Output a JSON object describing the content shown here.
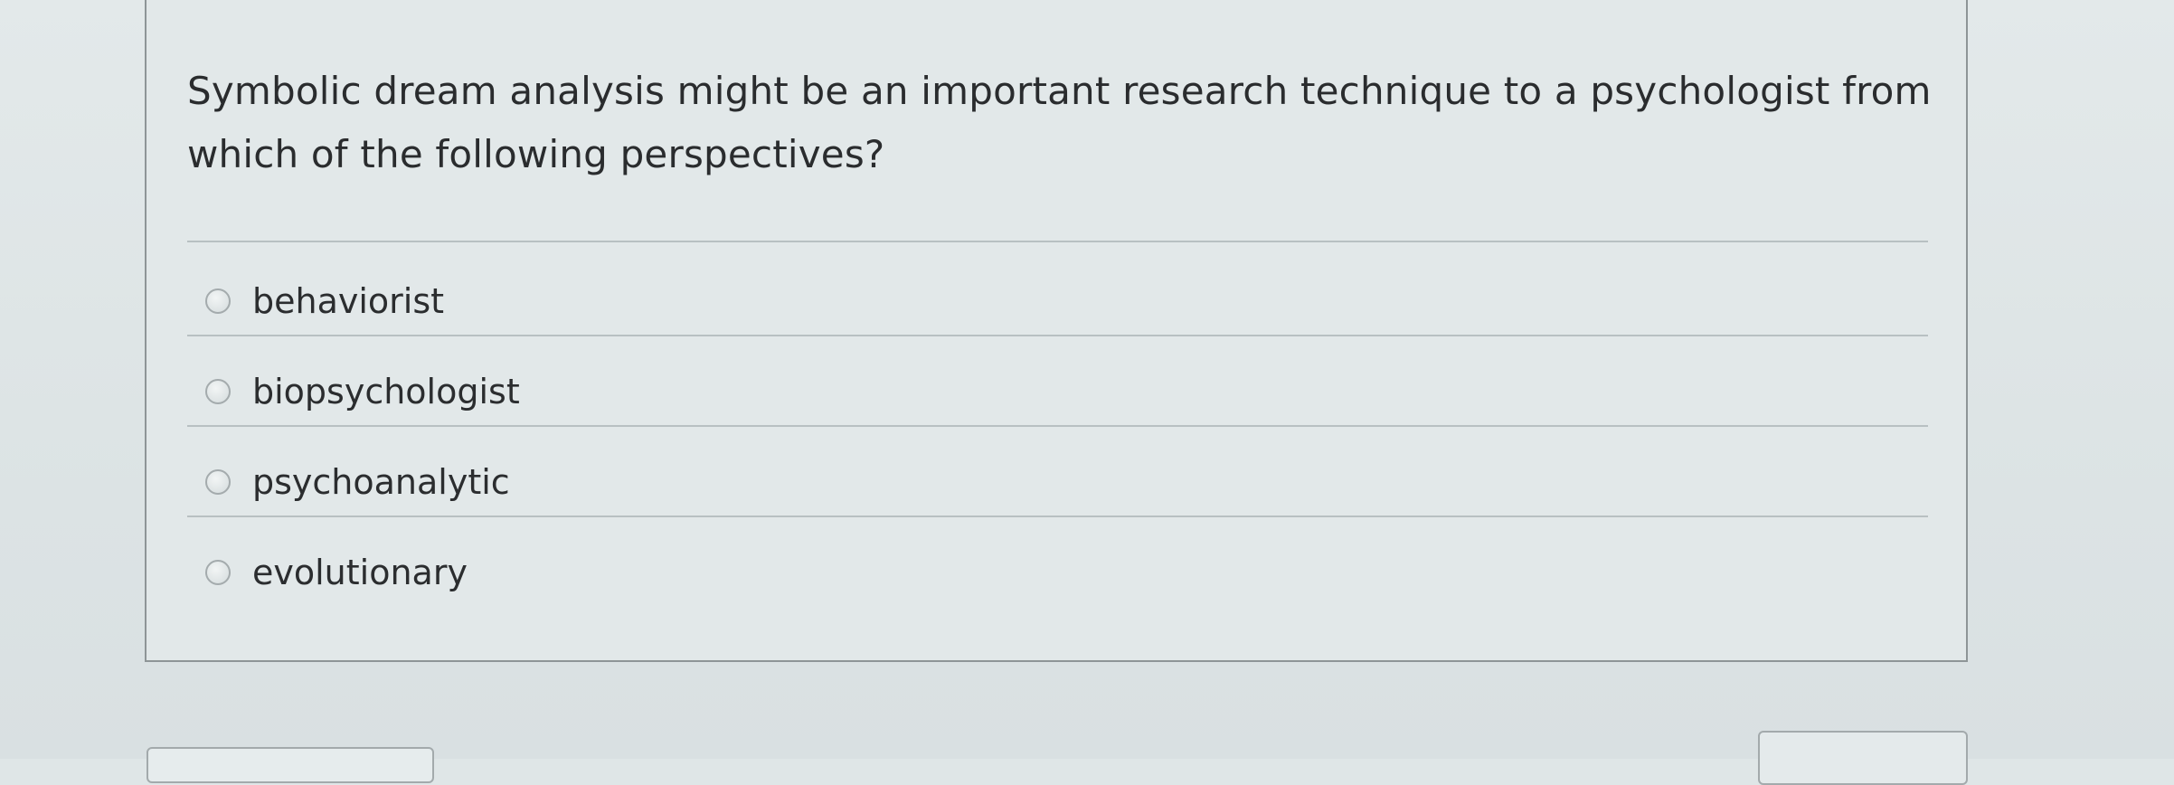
{
  "question": {
    "text": "Symbolic dream analysis might be an important research technique to a psychologist from which of the following perspectives?"
  },
  "answers": [
    {
      "label": "behaviorist"
    },
    {
      "label": "biopsychologist"
    },
    {
      "label": "psychoanalytic"
    },
    {
      "label": "evolutionary"
    }
  ]
}
